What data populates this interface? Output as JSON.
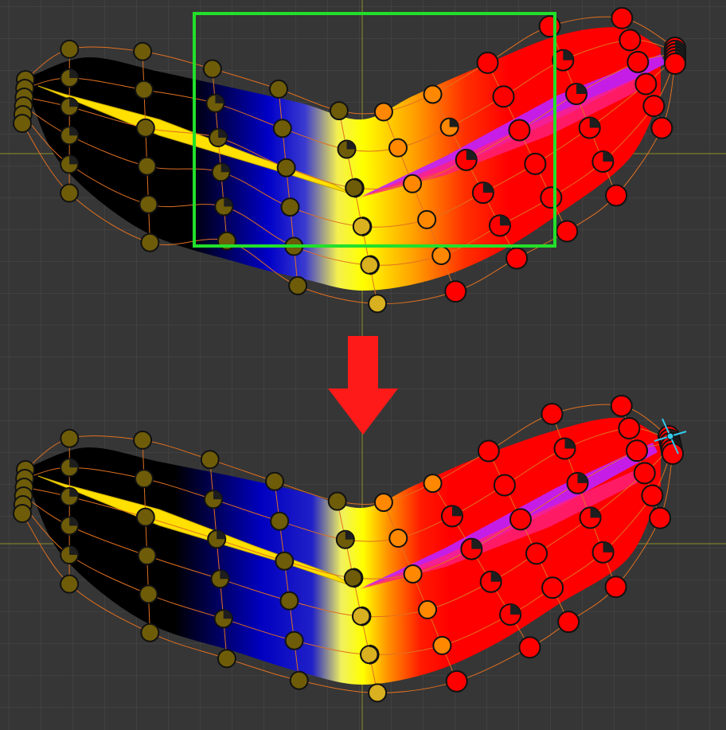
{
  "colors": {
    "background": "#363636",
    "grid": "#4a4a4a",
    "origin_line": "#8f8f2a",
    "selection_box": "#22e02a",
    "arrow": "#ff1a1a",
    "mesh_edge": "#e07020",
    "handle_olive": "#6e5c08",
    "handle_red": "#ff0000",
    "manipulator": "#33ccee"
  },
  "panels": [
    {
      "name": "before-panel",
      "has_selection_box": true,
      "has_manipulator": false
    },
    {
      "name": "after-panel",
      "has_selection_box": false,
      "has_manipulator": true
    }
  ],
  "icons": {
    "arrow": "down-arrow-icon",
    "manipulator": "move-manipulator-icon"
  }
}
